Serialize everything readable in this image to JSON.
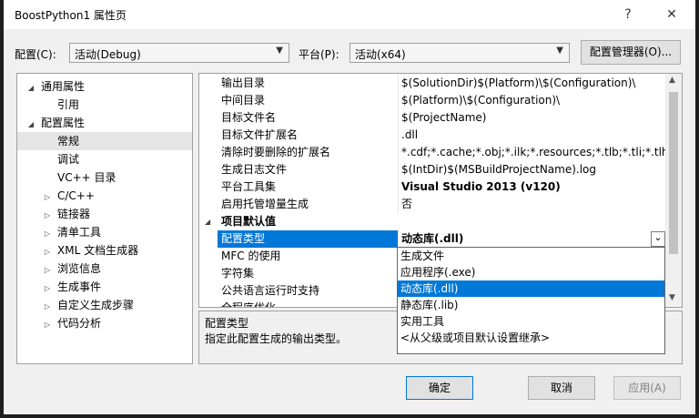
{
  "window": {
    "title": "BoostPython1 属性页",
    "help_glyph": "?",
    "close_glyph": "✕"
  },
  "toolbar": {
    "config_label": "配置(C):",
    "config_value": "活动(Debug)",
    "platform_label": "平台(P):",
    "platform_value": "活动(x64)",
    "config_manager_label": "配置管理器(O)..."
  },
  "tree": [
    {
      "label": "通用属性",
      "expander": "◢",
      "level": 0
    },
    {
      "label": "引用",
      "expander": "",
      "level": 1
    },
    {
      "label": "配置属性",
      "expander": "◢",
      "level": 0
    },
    {
      "label": "常规",
      "expander": "",
      "level": 1,
      "selected": true
    },
    {
      "label": "调试",
      "expander": "",
      "level": 1
    },
    {
      "label": "VC++ 目录",
      "expander": "",
      "level": 1
    },
    {
      "label": "C/C++",
      "expander": "▷",
      "level": 1
    },
    {
      "label": "链接器",
      "expander": "▷",
      "level": 1
    },
    {
      "label": "清单工具",
      "expander": "▷",
      "level": 1
    },
    {
      "label": "XML 文档生成器",
      "expander": "▷",
      "level": 1
    },
    {
      "label": "浏览信息",
      "expander": "▷",
      "level": 1
    },
    {
      "label": "生成事件",
      "expander": "▷",
      "level": 1
    },
    {
      "label": "自定义生成步骤",
      "expander": "▷",
      "level": 1
    },
    {
      "label": "代码分析",
      "expander": "▷",
      "level": 1
    }
  ],
  "grid": {
    "rows": [
      {
        "name": "输出目录",
        "value": "$(SolutionDir)$(Platform)\\$(Configuration)\\"
      },
      {
        "name": "中间目录",
        "value": "$(Platform)\\$(Configuration)\\"
      },
      {
        "name": "目标文件名",
        "value": "$(ProjectName)"
      },
      {
        "name": "目标文件扩展名",
        "value": ".dll"
      },
      {
        "name": "清除时要删除的扩展名",
        "value": "*.cdf;*.cache;*.obj;*.ilk;*.resources;*.tlb;*.tli;*.tlh;*.tmp"
      },
      {
        "name": "生成日志文件",
        "value": "$(IntDir)$(MSBuildProjectName).log"
      },
      {
        "name": "平台工具集",
        "value": "Visual Studio 2013 (v120)",
        "bold": true
      },
      {
        "name": "启用托管增量生成",
        "value": "否"
      }
    ],
    "category": {
      "label": "项目默认值",
      "expander": "◢"
    },
    "rows2": [
      {
        "name": "配置类型",
        "value": "动态库(.dll)",
        "bold": true,
        "selected": true
      },
      {
        "name": "MFC 的使用",
        "value": ""
      },
      {
        "name": "字符集",
        "value": ""
      },
      {
        "name": "公共语言运行时支持",
        "value": ""
      },
      {
        "name": "全程序优化",
        "value": ""
      }
    ]
  },
  "dropdown": {
    "arrow": "⌄",
    "options": [
      "生成文件",
      "应用程序(.exe)",
      "动态库(.dll)",
      "静态库(.lib)",
      "实用工具",
      "<从父级或项目默认设置继承>"
    ],
    "selected_index": 2
  },
  "description": {
    "title": "配置类型",
    "text": "指定此配置生成的输出类型。"
  },
  "buttons": {
    "ok": "确定",
    "cancel": "取消",
    "apply": "应用(A)"
  }
}
